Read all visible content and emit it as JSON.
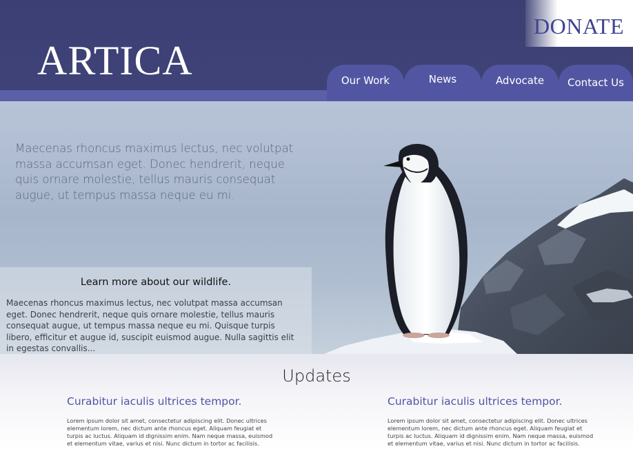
{
  "header": {
    "logo": "ARTICA",
    "donate_label": "DONATE"
  },
  "nav": {
    "items": [
      {
        "label": "Our Work"
      },
      {
        "label": "News"
      },
      {
        "label": "Advocate"
      },
      {
        "label": "Contact Us"
      }
    ]
  },
  "hero": {
    "intro_text": "Maecenas rhoncus maximus lectus, nec volutpat massa accumsan eget. Donec hendrerit, neque quis ornare molestie, tellus mauris consequat augue, ut tempus massa neque eu mi.",
    "info_title": "Learn more about our wildlife.",
    "info_text": "Maecenas rhoncus maximus lectus, nec volutpat massa accumsan eget. Donec hendrerit, neque quis ornare molestie, tellus mauris consequat augue, ut tempus massa neque eu mi. Quisque turpis libero, efficitur et augue id, suscipit euismod augue. Nulla sagittis elit in egestas convallis..."
  },
  "updates": {
    "title": "Updates",
    "items": [
      {
        "heading": "Curabitur iaculis ultrices tempor.",
        "body": "Lorem ipsum dolor sit amet, consectetur adipiscing elit. Donec ultrices elementum lorem, nec dictum ante rhoncus eget. Aliquam feugiat et turpis ac luctus. Aliquam id dignissim enim. Nam neque massa, euismod et elementum vitae, varius et nisi. Nunc dictum in tortor ac facilisis."
      },
      {
        "heading": "Curabitur iaculis ultrices tempor.",
        "body": "Lorem ipsum dolor sit amet, consectetur adipiscing elit. Donec ultrices elementum lorem, nec dictum ante rhoncus eget. Aliquam feugiat et turpis ac luctus. Aliquam id dignissim enim. Nam neque massa, euismod et elementum vitae, varius et nisi. Nunc dictum in tortor ac facilisis."
      }
    ]
  },
  "colors": {
    "header_bg": "#3f4378",
    "nav_tab": "#5256a2",
    "accent": "#4f53a4"
  }
}
